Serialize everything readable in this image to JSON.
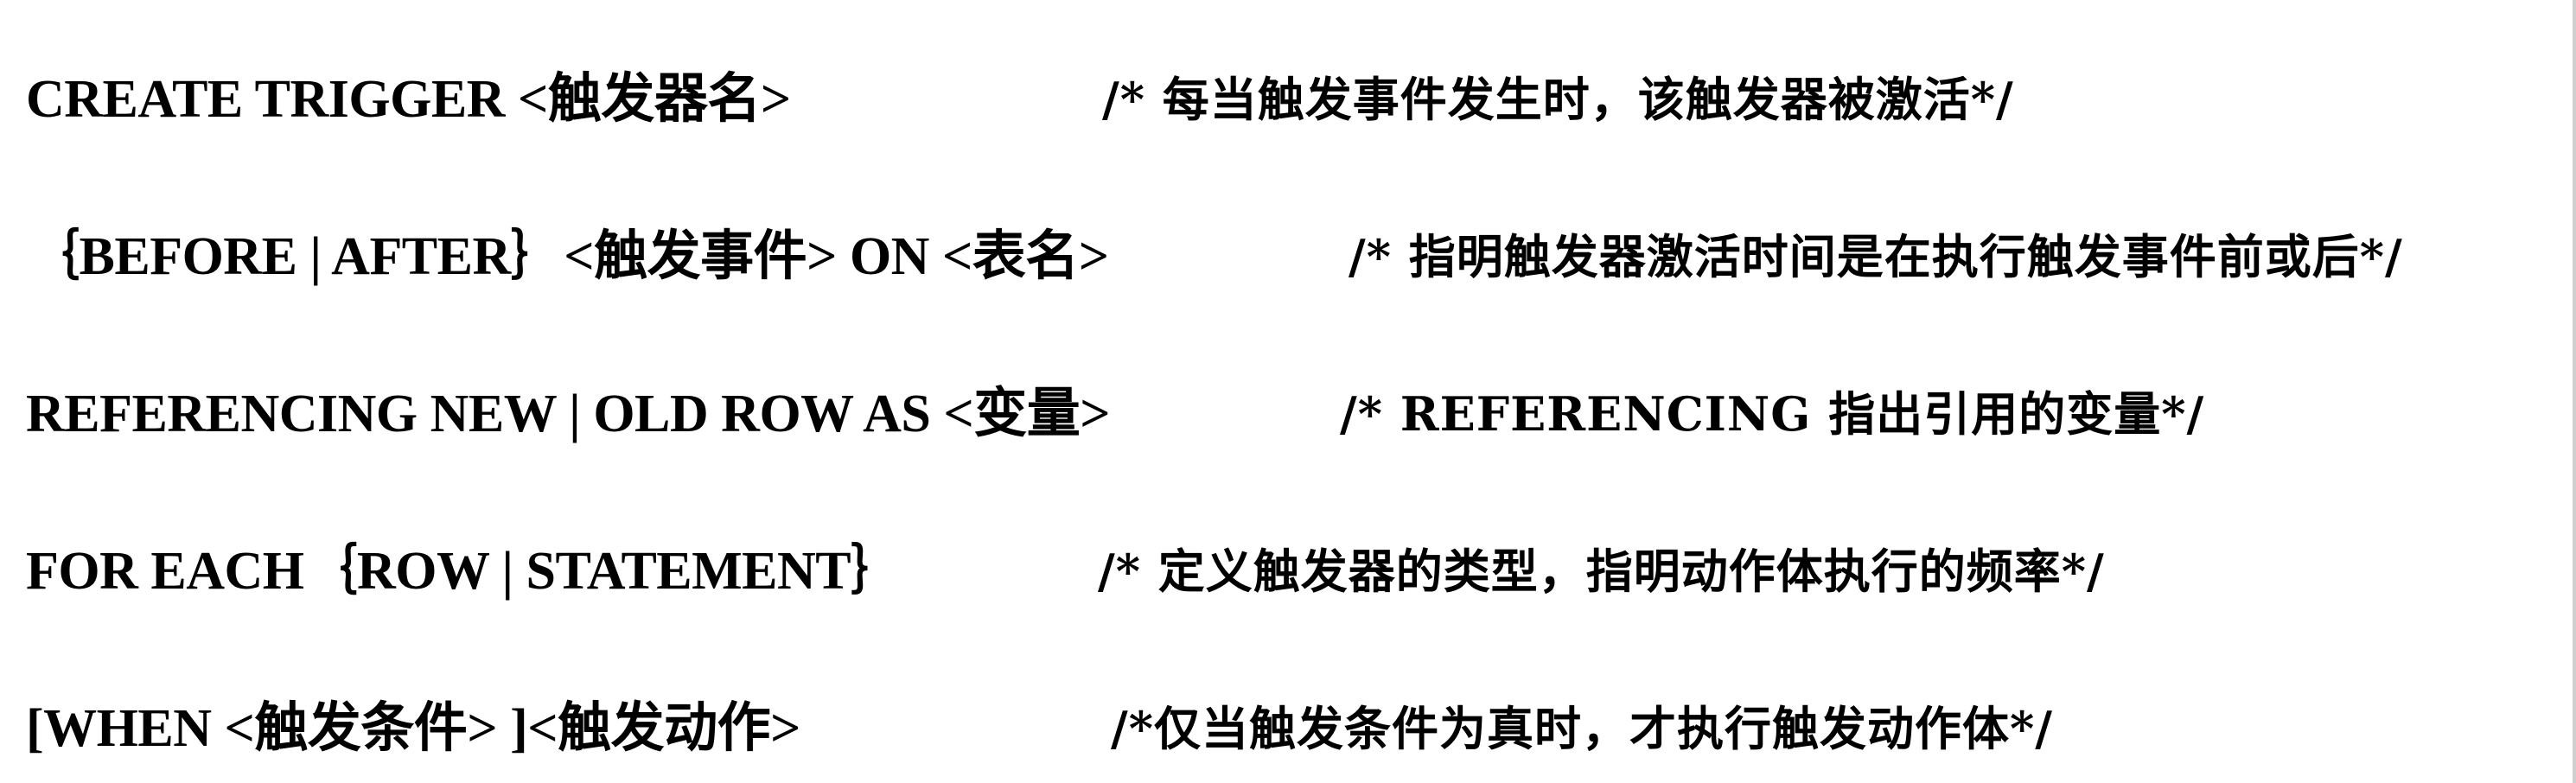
{
  "document": {
    "lines": [
      {
        "code": "CREATE TRIGGER <触发器名>",
        "comment": "/* 每当触发事件发生时，该触发器被激活*/"
      },
      {
        "code": "｛BEFORE | AFTER｝<触发事件>  ON <表名>",
        "comment": "/* 指明触发器激活时间是在执行触发事件前或后*/"
      },
      {
        "code": "REFERENCING NEW | OLD ROW AS  <变量>",
        "comment": "/* REFERENCING 指出引用的变量*/"
      },
      {
        "code": "FOR EACH｛ROW | STATEMENT｝",
        "comment": "/* 定义触发器的类型，指明动作体执行的频率*/"
      },
      {
        "code": "[WHEN <触发条件> ]<触发动作>",
        "comment": "/*仅当触发条件为真时，才执行触发动作体*/"
      }
    ]
  }
}
